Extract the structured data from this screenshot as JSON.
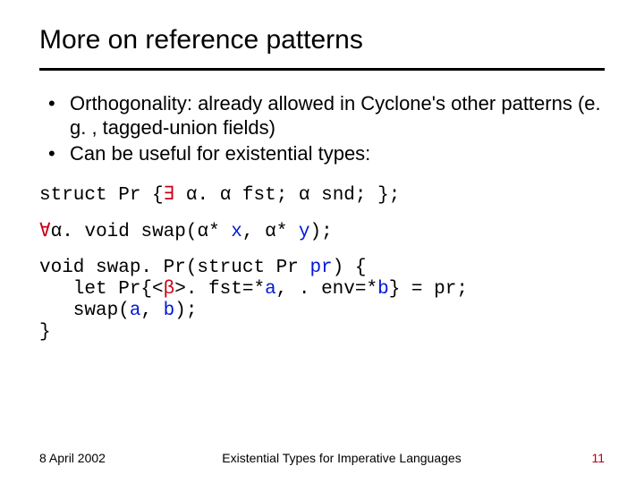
{
  "title": "More on reference patterns",
  "bullets": [
    "Orthogonality: already allowed in Cyclone's other patterns (e. g. , tagged-union fields)",
    "Can be useful for existential types:"
  ],
  "code1": {
    "p1": "struct Pr {",
    "exists": "∃",
    "p2": " α. α fst; α snd; };"
  },
  "code2": {
    "forall": "∀",
    "p1": "α. void swap(α* ",
    "x": "x",
    "p2": ", α* ",
    "y": "y",
    "p3": ");"
  },
  "code3": {
    "l1a": "void swap. Pr(struct Pr ",
    "l1pr": "pr",
    "l1b": ") {",
    "l2a": "   let Pr{<",
    "l2beta": "β",
    "l2b": ">. fst=*",
    "l2av": "a",
    "l2c": ", . env=*",
    "l2bv": "b",
    "l2d": "} = pr;",
    "l3a": "   swap(",
    "l3av": "a",
    "l3c": ", ",
    "l3bv": "b",
    "l3d": ");",
    "l4": "}"
  },
  "footer": {
    "date": "8 April 2002",
    "mid": "Existential Types for Imperative Languages",
    "page": "11"
  }
}
